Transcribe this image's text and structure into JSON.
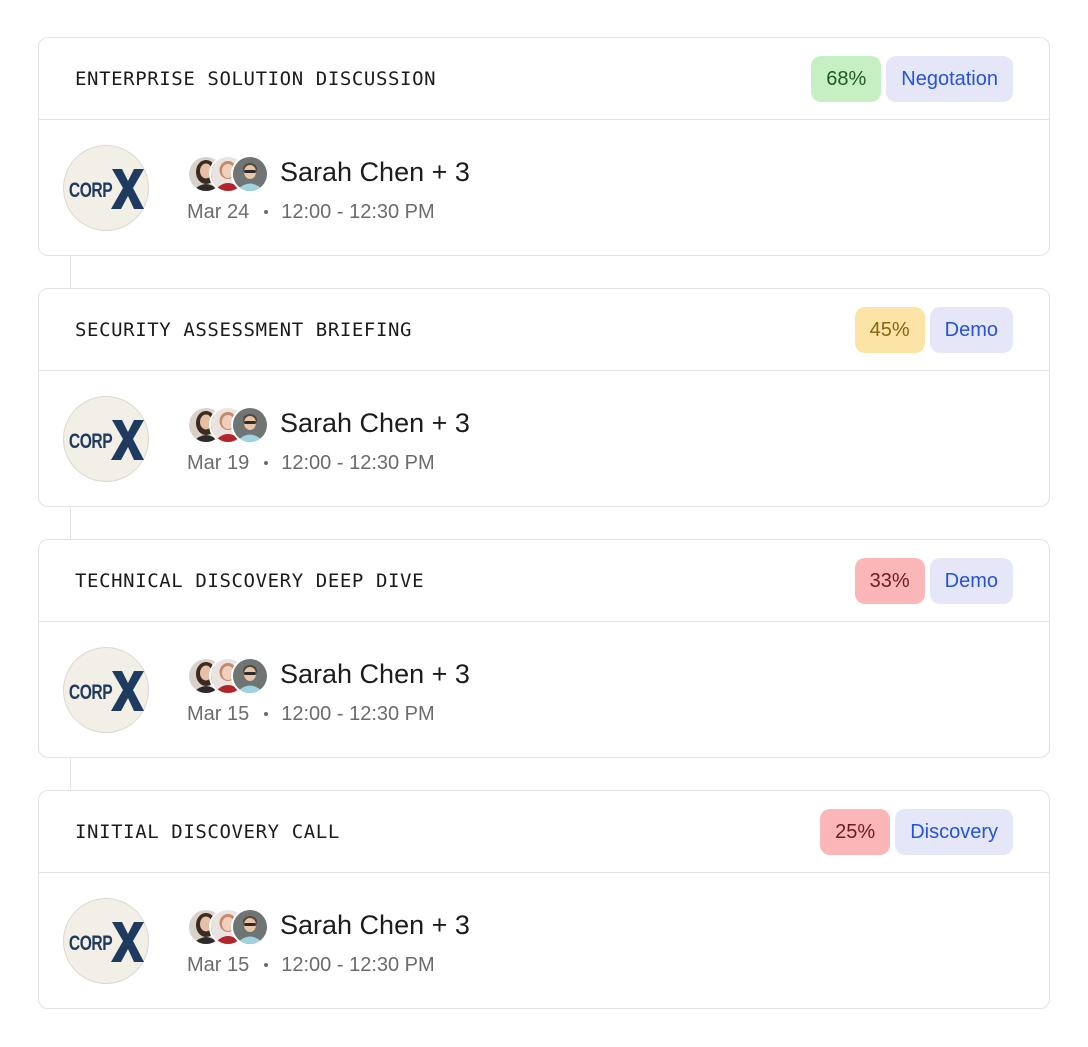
{
  "meetings": [
    {
      "title": "ENTERPRISE SOLUTION DISCUSSION",
      "probability": "68%",
      "probability_color": "green",
      "stage": "Negotation",
      "company_logo": "CORPX",
      "attendees": "Sarah Chen + 3",
      "date": "Mar 24",
      "time": "12:00 - 12:30 PM"
    },
    {
      "title": "SECURITY ASSESSMENT BRIEFING",
      "probability": "45%",
      "probability_color": "yellow",
      "stage": "Demo",
      "company_logo": "CORPX",
      "attendees": "Sarah Chen + 3",
      "date": "Mar 19",
      "time": "12:00 - 12:30 PM"
    },
    {
      "title": "TECHNICAL DISCOVERY DEEP DIVE",
      "probability": "33%",
      "probability_color": "red",
      "stage": "Demo",
      "company_logo": "CORPX",
      "attendees": "Sarah Chen + 3",
      "date": "Mar 15",
      "time": "12:00 - 12:30 PM"
    },
    {
      "title": "INITIAL DISCOVERY CALL",
      "probability": "25%",
      "probability_color": "red",
      "stage": "Discovery",
      "company_logo": "CORPX",
      "attendees": "Sarah Chen + 3",
      "date": "Mar 15",
      "time": "12:00 - 12:30 PM"
    }
  ],
  "colors": {
    "green_badge": "#c7efc4",
    "yellow_badge": "#fbe4a6",
    "red_badge": "#fbb6b8",
    "stage_badge": "#e5e7f8",
    "stage_text": "#2553d8",
    "logo_navy": "#1f3a5f"
  }
}
